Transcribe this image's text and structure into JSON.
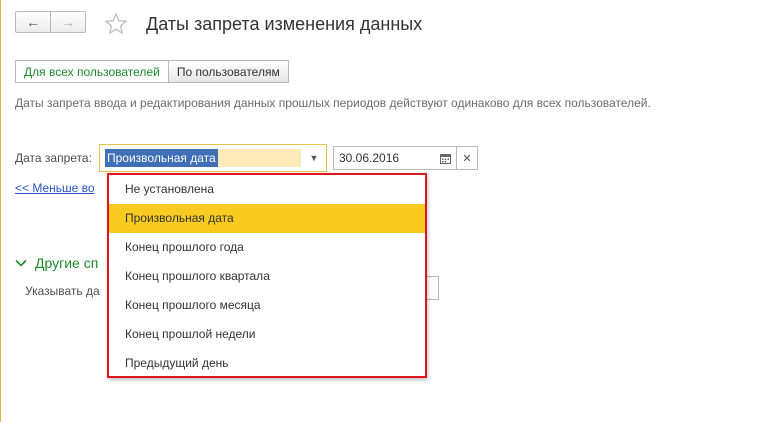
{
  "header": {
    "title": "Даты запрета изменения данных",
    "back_icon": "arrow-left-icon",
    "forward_icon": "arrow-right-icon",
    "favorite_icon": "star-icon"
  },
  "mode_toggle": {
    "all_users": "Для всех пользователей",
    "by_user": "По пользователям"
  },
  "info_text": "Даты запрета ввода и редактирования данных прошлых периодов действуют одинаково для всех пользователей.",
  "date_ban": {
    "label": "Дата запрета:",
    "combo_value": "Произвольная дата",
    "date_value": "30.06.2016"
  },
  "less_link": "<< Меньше во",
  "other_section": {
    "title": "Другие сп",
    "indicate_label": "Указывать да"
  },
  "dropdown": {
    "items": [
      "Не установлена",
      "Произвольная дата",
      "Конец прошлого года",
      "Конец прошлого квартала",
      "Конец прошлого месяца",
      "Конец прошлой недели",
      "Предыдущий день"
    ],
    "selected_index": 1
  },
  "colors": {
    "accent_green": "#1d8a2c",
    "selection_yellow": "#f9ca20",
    "highlight_red": "#e0161e",
    "link_blue": "#2a55c5"
  }
}
